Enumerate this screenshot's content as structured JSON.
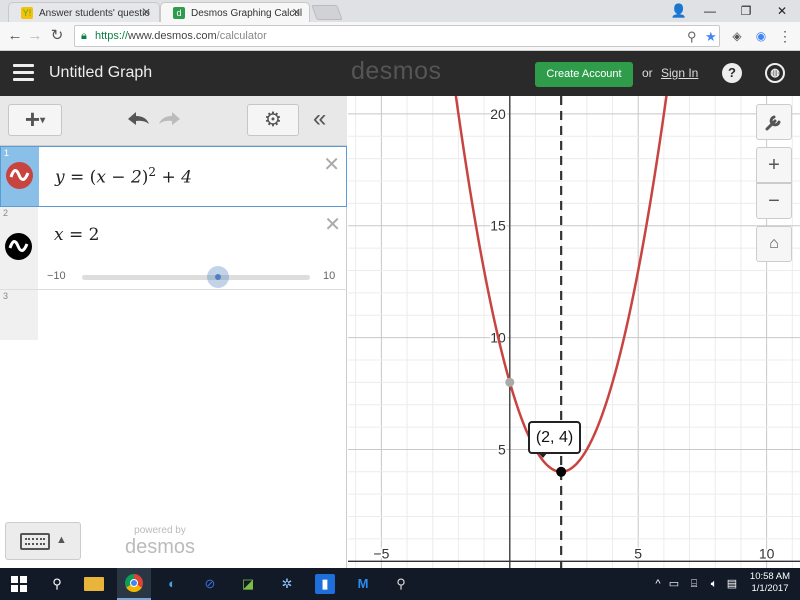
{
  "browser": {
    "tabs": [
      {
        "title": "Answer students' questio",
        "favicon": "yahoo-answers-icon",
        "active": false
      },
      {
        "title": "Desmos Graphing Calcul",
        "favicon": "desmos-icon",
        "active": true
      }
    ],
    "url_scheme": "https://",
    "url_host": "www.desmos.com",
    "url_path": "/calculator",
    "window_controls": [
      "—",
      "❐",
      "✕"
    ]
  },
  "header": {
    "menu_icon": "hamburger-icon",
    "title": "Untitled Graph",
    "logo": "desmos",
    "create_account": "Create Account",
    "or": "or",
    "sign_in": "Sign In",
    "help_icon": "?",
    "language_icon": "globe-icon"
  },
  "toolbar": {
    "add": "+",
    "undo_icon": "undo-icon",
    "redo_icon": "redo-icon",
    "settings_icon": "gear-icon",
    "collapse": "«"
  },
  "expressions": [
    {
      "number": "1",
      "latex_display": "y = (x − 2)² + 4",
      "color": "#c74440",
      "selected": true
    },
    {
      "number": "2",
      "latex_display": "x = 2",
      "color": "#000000",
      "slider_min": "−10",
      "slider_max": "10",
      "slider_value": 2
    },
    {
      "number": "3"
    }
  ],
  "powered_by": "powered by",
  "powered_logo": "desmos",
  "graph": {
    "point_label": "(2, 4)",
    "y_ticks": [
      "20",
      "15",
      "10",
      "5"
    ],
    "x_ticks": [
      "−5",
      "5",
      "10"
    ],
    "curve_color": "#c74440",
    "line_color": "#333333"
  },
  "chart_data": {
    "type": "line",
    "series": [
      {
        "name": "y = (x − 2)² + 4",
        "function": "(x-2)^2+4",
        "color": "#c74440"
      },
      {
        "name": "x = 2",
        "vertical_line_at_x": 2,
        "style": "dashed",
        "color": "#333333"
      }
    ],
    "points": [
      {
        "x": 2,
        "y": 4,
        "label": "(2, 4)"
      },
      {
        "x": 0,
        "y": 8,
        "label": ""
      }
    ],
    "xlim": [
      -6.3,
      11.3
    ],
    "ylim": [
      -0.3,
      20.8
    ],
    "grid": true
  },
  "taskbar": {
    "time": "10:58 AM",
    "date": "1/1/2017"
  }
}
